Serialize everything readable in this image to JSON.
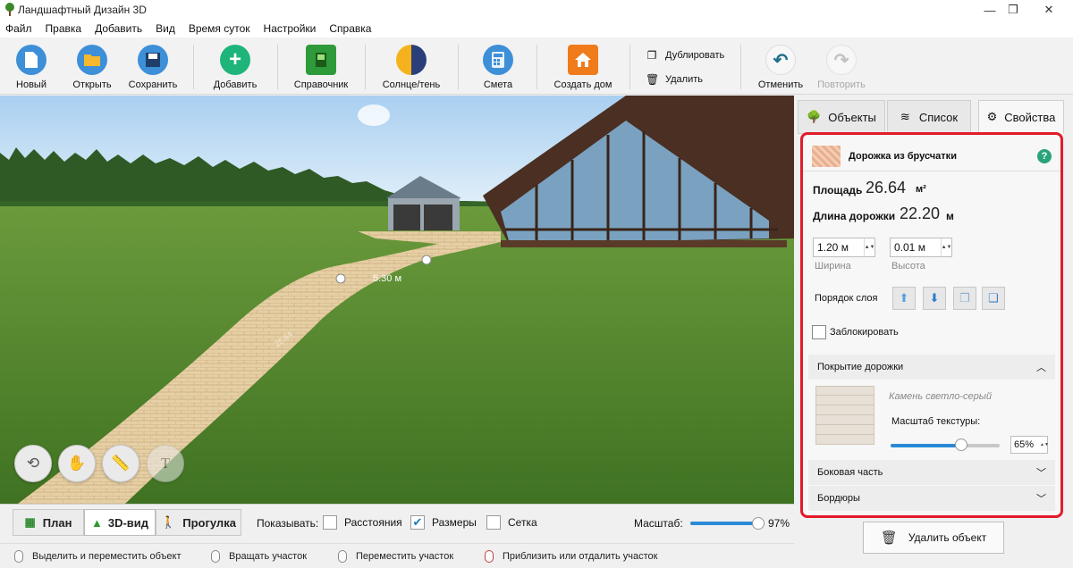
{
  "window": {
    "title": "Ландшафтный Дизайн 3D",
    "controls": {
      "minimize": "—",
      "maximize": "❐",
      "close": "✕"
    }
  },
  "menu": [
    "Файл",
    "Правка",
    "Добавить",
    "Вид",
    "Время суток",
    "Настройки",
    "Справка"
  ],
  "toolbar": {
    "new": "Новый",
    "open": "Открыть",
    "save": "Сохранить",
    "add": "Добавить",
    "reference": "Справочник",
    "sun_shadow": "Солнце/тень",
    "estimate": "Смета",
    "create_house": "Создать дом",
    "duplicate": "Дублировать",
    "delete": "Удалить",
    "undo": "Отменить",
    "redo": "Повторить"
  },
  "viewport": {
    "dimension_label": "5.30 м",
    "path_label": "26.64"
  },
  "modes": {
    "plan": "План",
    "view3d": "3D-вид",
    "walk": "Прогулка",
    "active": "3D-вид"
  },
  "show": {
    "label": "Показывать:",
    "distances": {
      "label": "Расстояния",
      "checked": false
    },
    "sizes": {
      "label": "Размеры",
      "checked": true
    },
    "grid": {
      "label": "Сетка",
      "checked": false
    }
  },
  "scale": {
    "label": "Масштаб:",
    "value": "97%",
    "level": 0.97
  },
  "status": {
    "select_move": "Выделить и переместить объект",
    "rotate": "Вращать участок",
    "move": "Переместить участок",
    "zoom": "Приблизить или отдалить участок"
  },
  "tabs": {
    "objects": "Объекты",
    "list": "Список",
    "properties": "Свойства",
    "active": "Свойства"
  },
  "properties": {
    "title": "Дорожка из брусчатки",
    "help": "?",
    "area_label": "Площадь",
    "area_value": "26.64",
    "area_unit": "м²",
    "length_label": "Длина дорожки",
    "length_value": "22.20",
    "length_unit": "м",
    "width_value": "1.20 м",
    "width_label": "Ширина",
    "height_value": "0.01 м",
    "height_label": "Высота",
    "layer_order_label": "Порядок слоя",
    "lock_label": "Заблокировать",
    "locked": false,
    "coating_section": "Покрытие дорожки",
    "material_name": "Камень светло-серый",
    "texture_scale_label": "Масштаб текстуры:",
    "texture_scale_value": "65%",
    "texture_scale_level": 0.65,
    "side_section": "Боковая часть",
    "borders_section": "Бордюры",
    "delete_button": "Удалить объект"
  },
  "colors": {
    "accent_red": "#e21b2b",
    "grass": "#4a7a2a",
    "sky": "#cfe6f7",
    "slider": "#2a8ad8"
  }
}
